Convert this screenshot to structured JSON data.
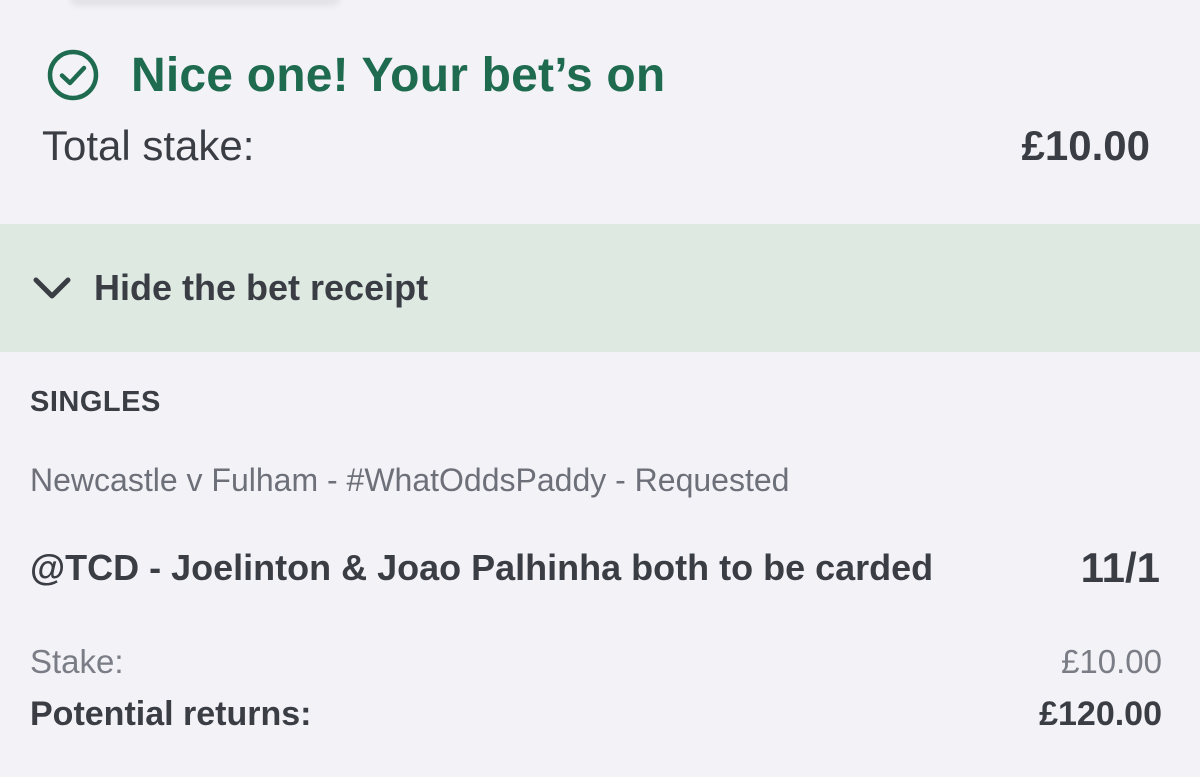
{
  "confirmation": {
    "icon": "check-circle-icon",
    "title": "Nice one! Your bet’s on",
    "total_stake_label": "Total stake:",
    "total_stake_value": "£10.00"
  },
  "receipt_toggle": {
    "icon": "chevron-down-icon",
    "label": "Hide the bet receipt"
  },
  "receipt": {
    "section_label": "SINGLES",
    "event": "Newcastle v Fulham - #WhatOddsPaddy - Requested",
    "selection": "@TCD - Joelinton & Joao Palhinha both to be carded",
    "odds": "11/1",
    "stake_label": "Stake:",
    "stake_value": "£10.00",
    "returns_label": "Potential returns:",
    "returns_value": "£120.00"
  },
  "colors": {
    "brand_green": "#1f6b50",
    "toggle_bg": "#dde9e1",
    "page_bg": "#f2f2f7",
    "text_dark": "#3a3d44",
    "text_muted": "#6d7079"
  }
}
